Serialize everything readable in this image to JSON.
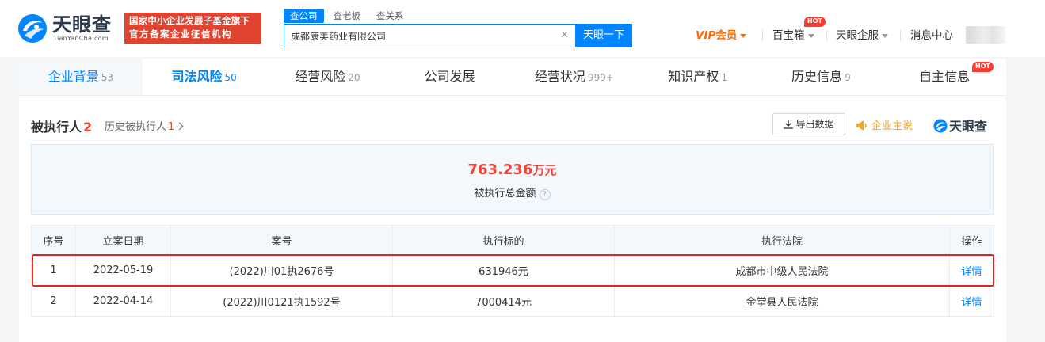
{
  "header": {
    "logo_name": "天眼查",
    "logo_domain": "TianYanCha.com",
    "slogan_line1": "国家中小企业发展子基金旗下",
    "slogan_line2": "官方备案企业征信机构",
    "search_tabs": [
      "查公司",
      "查老板",
      "查关系"
    ],
    "search_value": "成都康美药业有限公司",
    "search_button": "天眼一下",
    "vip_label": "VIP",
    "vip_suffix": "会员",
    "baibaoxiang": "百宝箱",
    "hot_badge": "HOT",
    "qifu": "天眼企服",
    "messages": "消息中心"
  },
  "tabs": [
    {
      "label": "企业背景",
      "count": "53"
    },
    {
      "label": "司法风险",
      "count": "50"
    },
    {
      "label": "经营风险",
      "count": "20"
    },
    {
      "label": "公司发展",
      "count": ""
    },
    {
      "label": "经营状况",
      "count": "999+"
    },
    {
      "label": "知识产权",
      "count": "1"
    },
    {
      "label": "历史信息",
      "count": "9"
    },
    {
      "label": "自主信息",
      "count": "",
      "badge": "HOT"
    }
  ],
  "section": {
    "title": "被执行人",
    "count": "2",
    "history_label": "历史被执行人",
    "history_count": "1",
    "export_label": "导出数据",
    "owner_label": "企业主说",
    "brand": "天眼查"
  },
  "summary": {
    "amount": "763.236",
    "unit": "万元",
    "label": "被执行总金额",
    "help": "?"
  },
  "table": {
    "headers": [
      "序号",
      "立案日期",
      "案号",
      "执行标的",
      "执行法院",
      "操作"
    ],
    "rows": [
      {
        "no": "1",
        "date": "2022-05-19",
        "case": "(2022)川01执2676号",
        "amount": "631946元",
        "court": "成都市中级人民法院",
        "action": "详情"
      },
      {
        "no": "2",
        "date": "2022-04-14",
        "case": "(2022)川0121执1592号",
        "amount": "7000414元",
        "court": "金堂县人民法院",
        "action": "详情"
      }
    ]
  },
  "colors": {
    "accent": "#0084ff",
    "danger": "#f04134",
    "highlight": "#e8231f",
    "vip": "#ff6a00"
  }
}
